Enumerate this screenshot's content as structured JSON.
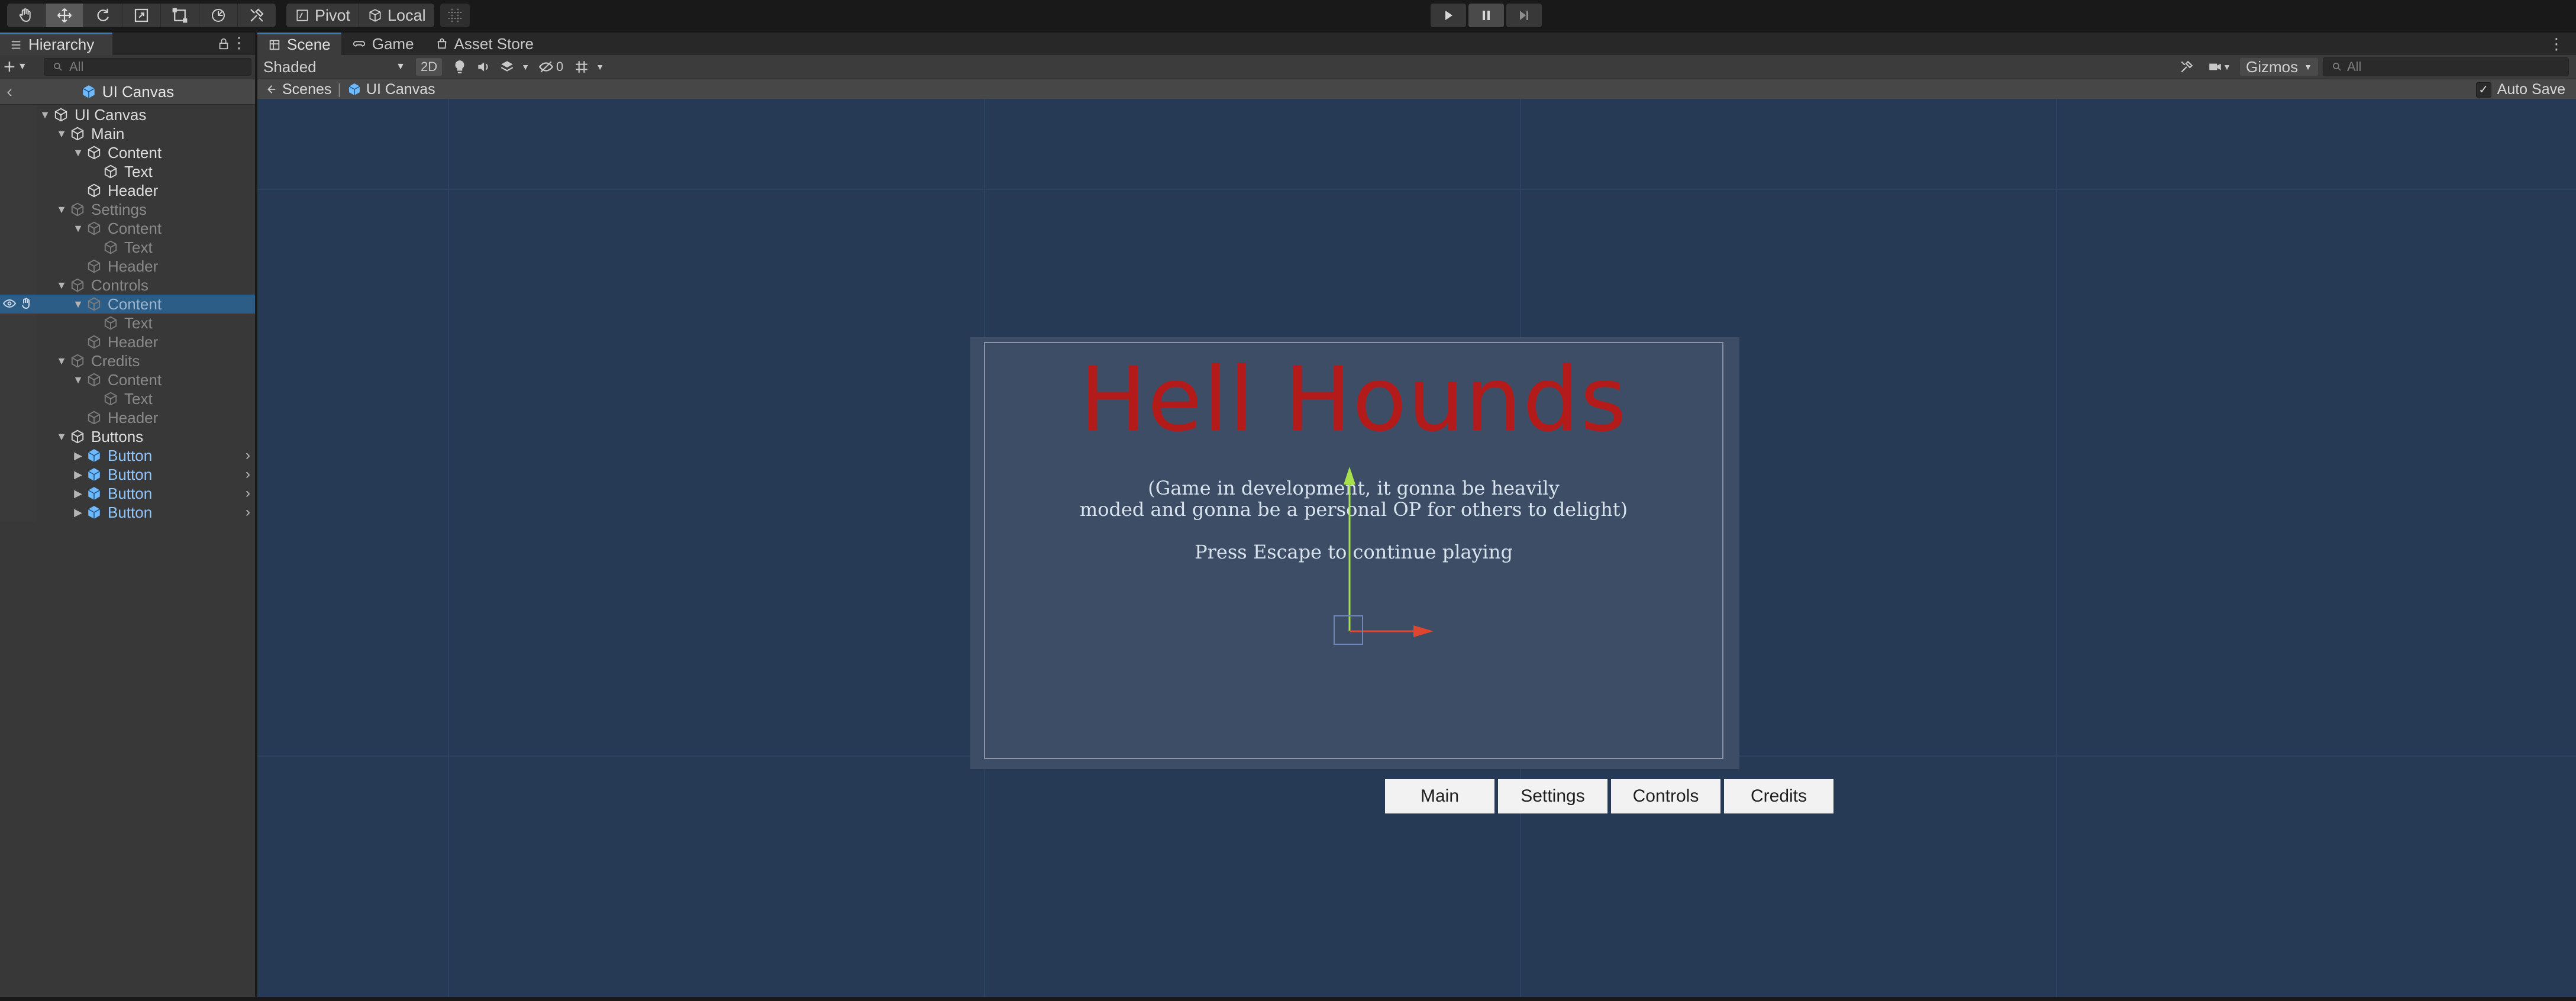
{
  "toolbar": {
    "tools": [
      "hand-icon",
      "move-icon",
      "rotate-icon",
      "scale-icon",
      "rect-icon",
      "transform-icon",
      "custom-tool-icon"
    ],
    "pivot_label": "Pivot",
    "local_label": "Local",
    "grid_snap": "grid-snap-icon",
    "play": "play-icon",
    "pause": "pause-icon",
    "step": "step-icon"
  },
  "hierarchy": {
    "tab_label": "Hierarchy",
    "search_placeholder": "All",
    "prefab_title": "UI Canvas",
    "items": [
      {
        "label": "UI Canvas",
        "depth": 0,
        "arrow": "▼",
        "style": "normal"
      },
      {
        "label": "Main",
        "depth": 1,
        "arrow": "▼",
        "style": "normal"
      },
      {
        "label": "Content",
        "depth": 2,
        "arrow": "▼",
        "style": "normal"
      },
      {
        "label": "Text",
        "depth": 3,
        "arrow": "",
        "style": "normal"
      },
      {
        "label": "Header",
        "depth": 2,
        "arrow": "",
        "style": "normal"
      },
      {
        "label": "Settings",
        "depth": 1,
        "arrow": "▼",
        "style": "dim"
      },
      {
        "label": "Content",
        "depth": 2,
        "arrow": "▼",
        "style": "dim"
      },
      {
        "label": "Text",
        "depth": 3,
        "arrow": "",
        "style": "dim"
      },
      {
        "label": "Header",
        "depth": 2,
        "arrow": "",
        "style": "dim"
      },
      {
        "label": "Controls",
        "depth": 1,
        "arrow": "▼",
        "style": "dim"
      },
      {
        "label": "Content",
        "depth": 2,
        "arrow": "▼",
        "style": "selected"
      },
      {
        "label": "Text",
        "depth": 3,
        "arrow": "",
        "style": "dim"
      },
      {
        "label": "Header",
        "depth": 2,
        "arrow": "",
        "style": "dim"
      },
      {
        "label": "Credits",
        "depth": 1,
        "arrow": "▼",
        "style": "dim"
      },
      {
        "label": "Content",
        "depth": 2,
        "arrow": "▼",
        "style": "dim"
      },
      {
        "label": "Text",
        "depth": 3,
        "arrow": "",
        "style": "dim"
      },
      {
        "label": "Header",
        "depth": 2,
        "arrow": "",
        "style": "dim"
      },
      {
        "label": "Buttons",
        "depth": 1,
        "arrow": "▼",
        "style": "normal"
      },
      {
        "label": "Button",
        "depth": 2,
        "arrow": "▶",
        "style": "blue"
      },
      {
        "label": "Button",
        "depth": 2,
        "arrow": "▶",
        "style": "blue"
      },
      {
        "label": "Button",
        "depth": 2,
        "arrow": "▶",
        "style": "blue"
      },
      {
        "label": "Button",
        "depth": 2,
        "arrow": "▶",
        "style": "blue"
      }
    ]
  },
  "scene": {
    "tabs": [
      {
        "label": "Scene",
        "icon": "scene-icon"
      },
      {
        "label": "Game",
        "icon": "game-controller-icon"
      },
      {
        "label": "Asset Store",
        "icon": "store-bag-icon"
      }
    ],
    "shading_mode": "Shaded",
    "mode_2d": "2D",
    "hidden_count": "0",
    "gizmos_label": "Gizmos",
    "search_placeholder": "All",
    "breadcrumb": [
      "Scenes",
      "UI Canvas"
    ],
    "auto_save_label": "Auto Save",
    "auto_save_checked": "✓"
  },
  "game_ui": {
    "title": "Hell Hounds",
    "title_color": "#b31b1b",
    "line1": "(Game in development,  it gonna be heavily",
    "line2": "moded and gonna be a personal OP for others to delight)",
    "line3": "Press Escape to continue playing",
    "buttons": [
      "Main",
      "Settings",
      "Controls",
      "Credits"
    ]
  },
  "colors": {
    "selection": "#2c5d87",
    "prefab_blue": "#8fc6ff",
    "viewport_bg": "#263a56",
    "accent_tab": "#3a79bb"
  }
}
